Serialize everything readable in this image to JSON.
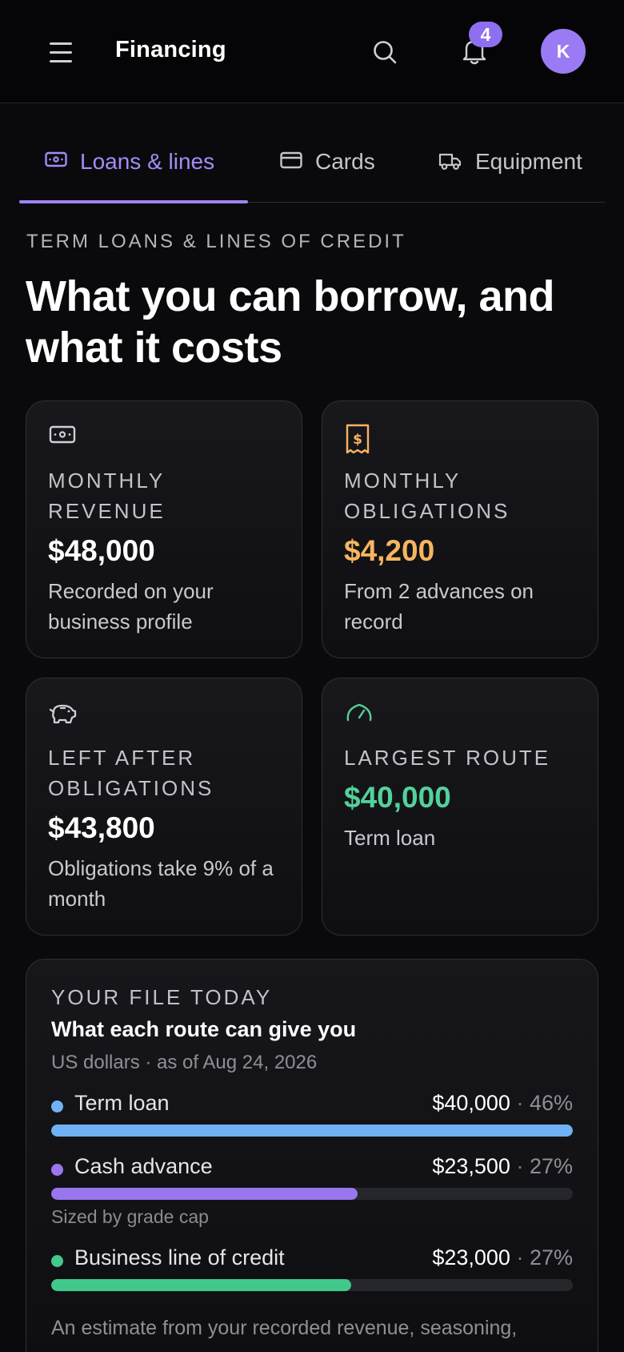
{
  "header": {
    "title": "Financing",
    "notification_count": "4",
    "avatar_initial": "K"
  },
  "tabs": [
    {
      "label": "Loans & lines",
      "icon": "banknote-icon",
      "active": true
    },
    {
      "label": "Cards",
      "icon": "credit-card-icon",
      "active": false
    },
    {
      "label": "Equipment",
      "icon": "truck-icon",
      "active": false
    }
  ],
  "section": {
    "eyebrow": "TERM LOANS & LINES OF CREDIT",
    "headline": "What you can borrow, and what it costs"
  },
  "stats": [
    {
      "icon": "banknote-icon",
      "label": "MONTHLY REVENUE",
      "value": "$48,000",
      "note": "Recorded on your business profile",
      "value_color": "#ffffff",
      "icon_color": "#cfcfd6"
    },
    {
      "icon": "receipt-icon",
      "label": "MONTHLY OBLIGATIONS",
      "value": "$4,200",
      "note": "From 2 advances on record",
      "value_color": "#f6b560",
      "icon_color": "#f6b560"
    },
    {
      "icon": "piggy-bank-icon",
      "label": "LEFT AFTER OBLIGATIONS",
      "value": "$43,800",
      "note": "Obligations take 9% of a month",
      "value_color": "#ffffff",
      "icon_color": "#cfcfd6"
    },
    {
      "icon": "gauge-icon",
      "label": "LARGEST ROUTE",
      "value": "$40,000",
      "note": "Term loan",
      "value_color": "#52d29b",
      "icon_color": "#52d29b"
    }
  ],
  "file_panel": {
    "eyebrow": "YOUR FILE TODAY",
    "title": "What each route can give you",
    "subtitle": "US dollars · as of Aug 24, 2026",
    "routes": [
      {
        "name": "Term loan",
        "amount": "$40,000",
        "separator": " · ",
        "percent": "46%",
        "fill_fraction": 1.0,
        "color": "#6fb3f4",
        "note": ""
      },
      {
        "name": "Cash advance",
        "amount": "$23,500",
        "separator": " · ",
        "percent": "27%",
        "fill_fraction": 0.5875,
        "color": "#9a76ee",
        "note": "Sized by grade cap"
      },
      {
        "name": "Business line of credit",
        "amount": "$23,000",
        "separator": " · ",
        "percent": "27%",
        "fill_fraction": 0.575,
        "color": "#41c98c",
        "note": ""
      }
    ],
    "footnote": "An estimate from your recorded revenue, seasoning, obligations and credit. It is not an offer and not a hard"
  }
}
